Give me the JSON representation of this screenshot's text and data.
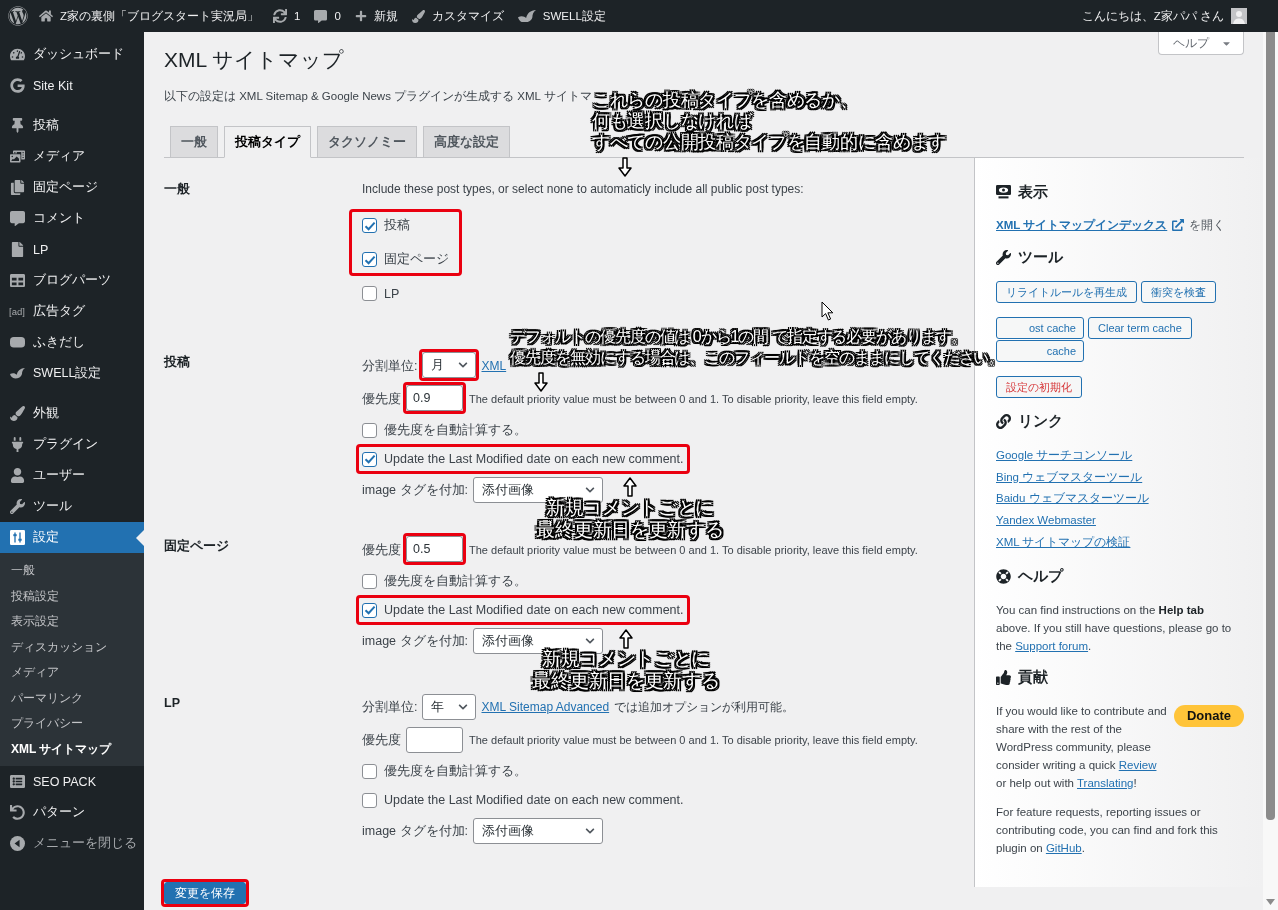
{
  "admin_bar": {
    "site_name": "Z家の裏側「ブログスタート実況局」",
    "updates": "1",
    "comments": "0",
    "new": "新規",
    "customize": "カスタマイズ",
    "theme_settings": "SWELL設定",
    "greeting": "こんにちは、Z家パパ さん"
  },
  "sidebar": {
    "groups": [
      {
        "items": [
          {
            "label": "ダッシュボード",
            "selected": false
          },
          {
            "label": "Site Kit",
            "selected": false
          }
        ]
      },
      {
        "items": [
          {
            "label": "投稿",
            "selected": false
          },
          {
            "label": "メディア",
            "selected": false
          },
          {
            "label": "固定ページ",
            "selected": false
          },
          {
            "label": "コメント",
            "selected": false
          },
          {
            "label": "LP",
            "selected": false
          },
          {
            "label": "ブログパーツ",
            "selected": false
          },
          {
            "label": "広告タグ",
            "selected": false,
            "icon_text": "[ad]"
          },
          {
            "label": "ふきだし",
            "selected": false
          },
          {
            "label": "SWELL設定",
            "selected": false
          }
        ]
      },
      {
        "items": [
          {
            "label": "外観",
            "selected": false
          },
          {
            "label": "プラグイン",
            "selected": false
          },
          {
            "label": "ユーザー",
            "selected": false
          },
          {
            "label": "ツール",
            "selected": false
          },
          {
            "label": "設定",
            "selected": true,
            "children": [
              {
                "label": "一般",
                "selected": false
              },
              {
                "label": "投稿設定",
                "selected": false
              },
              {
                "label": "表示設定",
                "selected": false
              },
              {
                "label": "ディスカッション",
                "selected": false
              },
              {
                "label": "メディア",
                "selected": false
              },
              {
                "label": "パーマリンク",
                "selected": false
              },
              {
                "label": "プライバシー",
                "selected": false
              },
              {
                "label": "XML サイトマップ",
                "selected": true
              }
            ]
          },
          {
            "label": "SEO PACK",
            "selected": false
          },
          {
            "label": "パターン",
            "selected": false
          }
        ]
      }
    ],
    "collapse": "メニューを閉じる"
  },
  "page": {
    "title": "XML サイトマップ",
    "help": "ヘルプ",
    "intro": "以下の設定は XML Sitemap & Google News プラグインが生成する XML サイトマ"
  },
  "tabs": [
    {
      "label": "一般",
      "selected": false
    },
    {
      "label": "投稿タイプ",
      "selected": true
    },
    {
      "label": "タクソノミー",
      "selected": false
    },
    {
      "label": "高度な設定",
      "selected": false
    }
  ],
  "form": {
    "sections": [
      {
        "kind": "post_types",
        "label": "一般",
        "description": "Include these post types, or select none to automaticly include all public post types:",
        "post_types": [
          {
            "label": "投稿",
            "checked": true,
            "highlighted": true
          },
          {
            "label": "固定ページ",
            "checked": true,
            "highlighted": true
          },
          {
            "label": "LP",
            "checked": false,
            "highlighted": false
          }
        ]
      },
      {
        "kind": "post_type",
        "label": "投稿",
        "split": {
          "label": "分割単位:",
          "value": "月",
          "highlighted": true,
          "link": "XML"
        },
        "priority": {
          "label": "優先度",
          "value": "0.9",
          "highlighted": true,
          "help": "The default priority value must be between 0 and 1. To disable priority, leave this field empty."
        },
        "options": [
          {
            "label": "優先度を自動計算する。",
            "checked": false,
            "highlighted": false
          },
          {
            "label": "Update the Last Modified date on each new comment.",
            "checked": true,
            "highlighted": true
          }
        ],
        "image": {
          "label": "image タグを付加:",
          "value": "添付画像",
          "highlighted": false
        }
      },
      {
        "kind": "post_type",
        "label": "固定ページ",
        "priority": {
          "label": "優先度",
          "value": "0.5",
          "highlighted": true,
          "help": "The default priority value must be between 0 and 1. To disable priority, leave this field empty."
        },
        "options": [
          {
            "label": "優先度を自動計算する。",
            "checked": false,
            "highlighted": false
          },
          {
            "label": "Update the Last Modified date on each new comment.",
            "checked": true,
            "highlighted": true
          }
        ],
        "image": {
          "label": "image タグを付加:",
          "value": "添付画像",
          "highlighted": false
        }
      },
      {
        "kind": "post_type",
        "label": "LP",
        "split": {
          "label": "分割単位:",
          "value": "年",
          "highlighted": false,
          "link": "XML Sitemap Advanced",
          "note": "では追加オプションが利用可能。"
        },
        "priority": {
          "label": "優先度",
          "highlighted": false,
          "help": "The default priority value must be between 0 and 1. To disable priority, leave this field empty."
        },
        "options": [
          {
            "label": "優先度を自動計算する。",
            "checked": false,
            "highlighted": false
          },
          {
            "label": "Update the Last Modified date on each new comment.",
            "checked": false,
            "highlighted": false
          }
        ],
        "image": {
          "label": "image タグを付加:",
          "value": "添付画像",
          "highlighted": false
        }
      }
    ],
    "save": {
      "label": "変更を保存",
      "highlighted": true
    }
  },
  "side_panel": {
    "sections": [
      {
        "kind": "view",
        "title": "表示",
        "link": "XML サイトマップインデックス",
        "suffix": "を開く"
      },
      {
        "kind": "tools",
        "title": "ツール",
        "button_groups": [
          [
            {
              "label": "リライトルールを再生成",
              "kind": "default"
            },
            {
              "label": "衝突を検査",
              "kind": "default"
            }
          ],
          [
            {
              "label": "ost cache",
              "kind": "default"
            },
            {
              "label": "Clear term cache",
              "kind": "default"
            },
            {
              "label": "cache",
              "kind": "default"
            }
          ],
          [
            {
              "label": "設定の初期化",
              "kind": "danger"
            }
          ]
        ]
      },
      {
        "kind": "links",
        "title": "リンク",
        "links": [
          "Google サーチコンソール",
          "Bing ウェブマスターツール",
          "Baidu ウェブマスターツール",
          "Yandex Webmaster",
          "XML サイトマップの検証"
        ]
      },
      {
        "kind": "help",
        "title": "ヘルプ",
        "paragraphs": [
          [
            {
              "text": "You can find instructions on the **Help tab** above. If you still have questions, please go to the "
            },
            {
              "link": "Support forum"
            },
            {
              "text": "."
            }
          ]
        ]
      },
      {
        "kind": "contribute",
        "title": "貢献",
        "donate": "Donate",
        "paragraphs": [
          [
            {
              "text": "If you would like to contribute and share with the rest of the WordPress community, please consider writing a quick "
            },
            {
              "link": "Review"
            },
            {
              "text": " or help out with "
            },
            {
              "link": "Translating"
            },
            {
              "text": "!"
            }
          ],
          [
            {
              "text": "For feature requests, reporting issues or contributing code, you can find and fork this plugin on "
            },
            {
              "link": "GitHub"
            },
            {
              "text": "."
            }
          ]
        ]
      }
    ]
  },
  "annotations": [
    {
      "lines": [
        "これらの投稿タイプを含めるか、",
        "何も選択しなければ",
        "すべての公開投稿タイプを自動的に含めます"
      ]
    },
    {
      "lines": [
        "デフォルトの優先度の値は 0から1の間 で指定する必要があります。",
        "優先度を無効にする場合は、このフィールドを空のままにしてください。"
      ]
    },
    {
      "lines": [
        "新規コメントごとに",
        "最終更新日を更新する"
      ]
    },
    {
      "lines": [
        "新規コメントごとに",
        "最終更新日を更新する"
      ]
    }
  ]
}
